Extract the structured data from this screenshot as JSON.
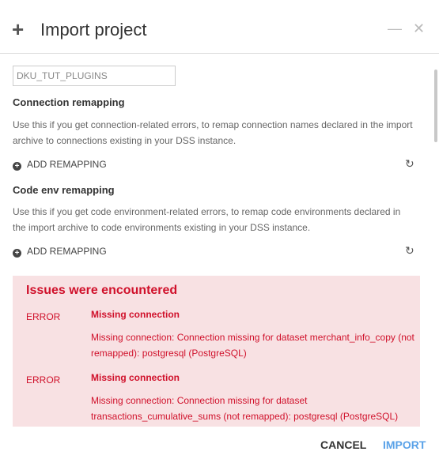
{
  "header": {
    "title": "Import project",
    "plus_icon": "plus-icon",
    "minimize_icon": "minimize-icon",
    "close_icon": "close-icon"
  },
  "form": {
    "project_key_value": "DKU_TUT_PLUGINS",
    "connection": {
      "heading": "Connection remapping",
      "description": "Use this if you get connection-related errors, to remap connection names declared in the import archive to connections existing in your DSS instance.",
      "add_label": "ADD REMAPPING"
    },
    "code_env": {
      "heading": "Code env remapping",
      "description": "Use this if you get code environment-related errors, to remap code environments declared in the import archive to code environments existing in your DSS instance.",
      "add_label": "ADD REMAPPING"
    }
  },
  "issues": {
    "title": "Issues were encountered",
    "bg_color": "#f8e1e3",
    "text_color": "#d0112b",
    "items": [
      {
        "level": "ERROR",
        "title": "Missing connection",
        "detail": "Missing connection: Connection missing for dataset merchant_info_copy (not remapped): postgresql (PostgreSQL)"
      },
      {
        "level": "ERROR",
        "title": "Missing connection",
        "detail": "Missing connection: Connection missing for dataset transactions_cumulative_sums (not remapped): postgresql (PostgreSQL)"
      }
    ]
  },
  "footer": {
    "cancel_label": "CANCEL",
    "import_label": "IMPORT",
    "import_color": "#5aa2e8"
  }
}
